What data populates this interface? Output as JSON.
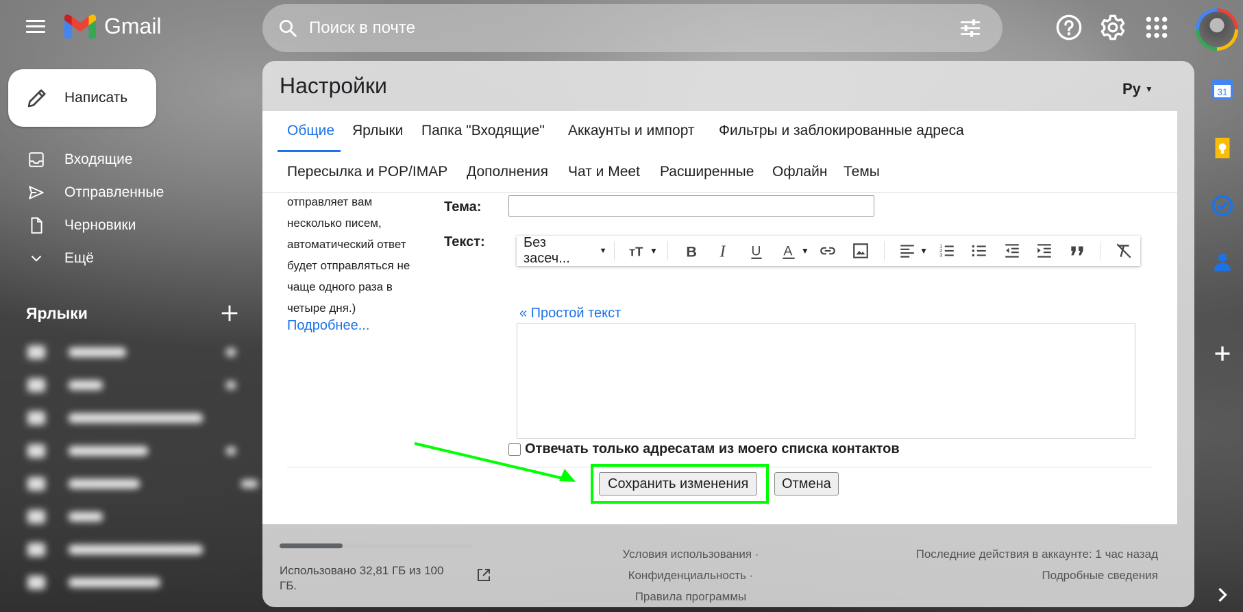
{
  "app": {
    "name": "Gmail"
  },
  "search": {
    "placeholder": "Поиск в почте"
  },
  "compose": {
    "label": "Написать"
  },
  "nav": [
    {
      "label": "Входящие",
      "icon": "inbox-icon"
    },
    {
      "label": "Отправленные",
      "icon": "send-icon"
    },
    {
      "label": "Черновики",
      "icon": "draft-icon"
    },
    {
      "label": "Ещё",
      "icon": "chevron-down-icon"
    }
  ],
  "labels_section": {
    "title": "Ярлыки"
  },
  "settings": {
    "title": "Настройки",
    "language": "Ру",
    "tabs_row1": [
      "Общие",
      "Ярлыки",
      "Папка \"Входящие\"",
      "Аккаунты и импорт",
      "Фильтры и заблокированные адреса"
    ],
    "tabs_row2": [
      "Пересылка и POP/IMAP",
      "Дополнения",
      "Чат и Meet",
      "Расширенные",
      "Офлайн",
      "Темы"
    ],
    "active_tab": "Общие",
    "description": [
      "отправляет вам",
      "несколько писем,",
      "автоматический ответ",
      "будет отправляться не",
      "чаще одного раза в",
      "четыре дня.)"
    ],
    "more_link": "Подробнее...",
    "subject_label": "Тема:",
    "subject_value": "",
    "text_label": "Текст:",
    "toolbar": {
      "font": "Без засеч..."
    },
    "plain_text_link": "« Простой текст",
    "contacts_only_label": "Отвечать только адресатам из моего списка контактов",
    "contacts_only_checked": false,
    "save_label": "Сохранить изменения",
    "cancel_label": "Отмена"
  },
  "footer": {
    "storage": "Использовано 32,81 ГБ из 100 ГБ.",
    "storage_used_fraction": 0.33,
    "links": {
      "terms": "Условия использования",
      "privacy": "Конфиденциальность",
      "program_policies": "Правила программы"
    },
    "activity": "Последние действия в аккаунте: 1 час назад",
    "details": "Подробные сведения"
  },
  "colors": {
    "accent": "#1a73e8",
    "highlight": "#00ff00"
  }
}
